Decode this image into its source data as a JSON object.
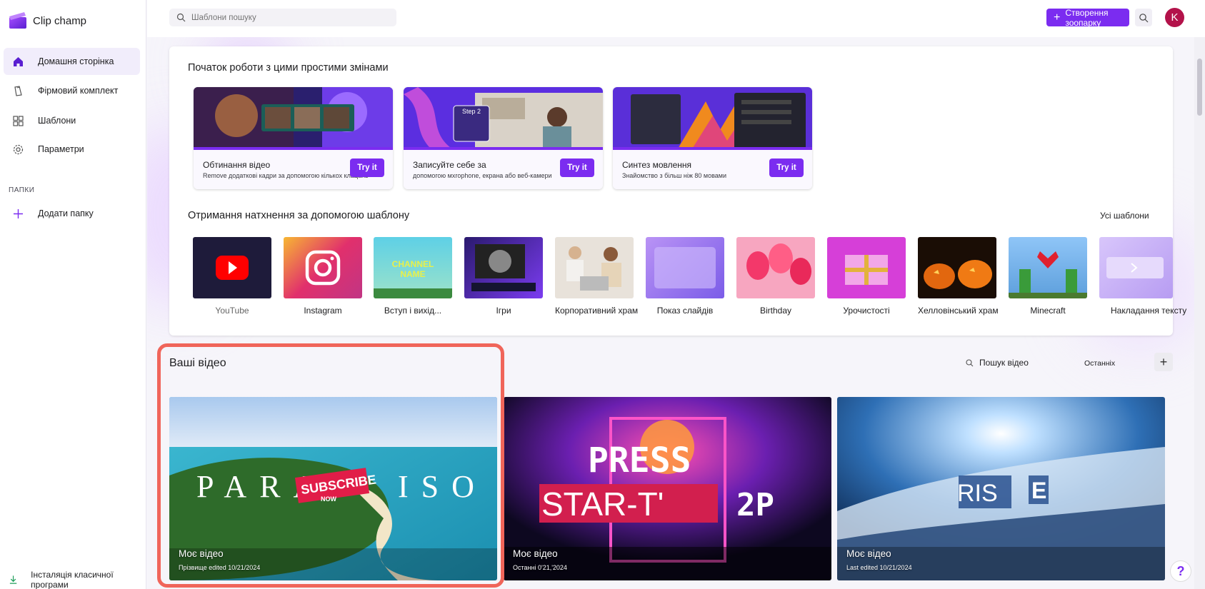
{
  "app": {
    "name": "Clip champ"
  },
  "sidebar": {
    "items": [
      {
        "label": "Домашня сторінка",
        "icon": "home-icon"
      },
      {
        "label": "Фірмовий комплект",
        "icon": "brand-kit-icon"
      },
      {
        "label": "Шаблони",
        "icon": "templates-icon"
      },
      {
        "label": "Параметри",
        "icon": "gear-icon"
      }
    ],
    "folders_label": "ПАПКИ",
    "add_folder": "Додати папку",
    "install": "Інсталяція класичної програми"
  },
  "topbar": {
    "search_placeholder": "Шаблони пошуку",
    "create_label": "Створення зоопарку",
    "avatar_initial": "K"
  },
  "quickstart": {
    "title": "Початок роботи з цими простими змінами",
    "cards": [
      {
        "title": "Обтинання відео",
        "subtitle": "Remove додаткові кадри за допомогою кількох клацань",
        "button": "Try it"
      },
      {
        "title": "Записуйте себе за",
        "subtitle": "допомогою мхrophone, екрана або веб-камери",
        "button": "Try it"
      },
      {
        "title": "Синтез мовлення",
        "subtitle": "Знайомство з більш ніж 80 мовами",
        "button": "Try it"
      }
    ]
  },
  "templates": {
    "title": "Отримання натхнення за допомогою шаблону",
    "all_label": "Усі шаблони",
    "items": [
      {
        "label": "YouTube"
      },
      {
        "label": "Instagram"
      },
      {
        "label": "Вступ і вихід..."
      },
      {
        "label": "Ігри"
      },
      {
        "label": "Корпоративний храм"
      },
      {
        "label": "Показ слайдів"
      },
      {
        "label": "Birthday"
      },
      {
        "label": "Урочистості"
      },
      {
        "label": "Хелловінський храм"
      },
      {
        "label": "Minecraft"
      },
      {
        "label": "Накладання тексту"
      }
    ]
  },
  "videos": {
    "title": "Ваші відео",
    "search_label": "Пошук відео",
    "sort_label": "Останніх",
    "items": [
      {
        "name": "Моє відео",
        "edited": "Прізвище edited 10/21/2024",
        "overlay": "PARADISO",
        "badge": "SUBSCRIBE",
        "badge_sub": "NOW"
      },
      {
        "name": "Моє відео",
        "edited": "Останні 0'21,'2024",
        "overlay": "PRESS",
        "overlay2": "STAR-T'",
        "overlay3": "2P"
      },
      {
        "name": "Моє відео",
        "edited": "Last edited 10/21/2024",
        "overlay": "RIS",
        "overlay2": "E"
      }
    ]
  },
  "colors": {
    "accent": "#7b2cf0",
    "highlight": "#f0655a",
    "avatar": "#b3124a"
  }
}
